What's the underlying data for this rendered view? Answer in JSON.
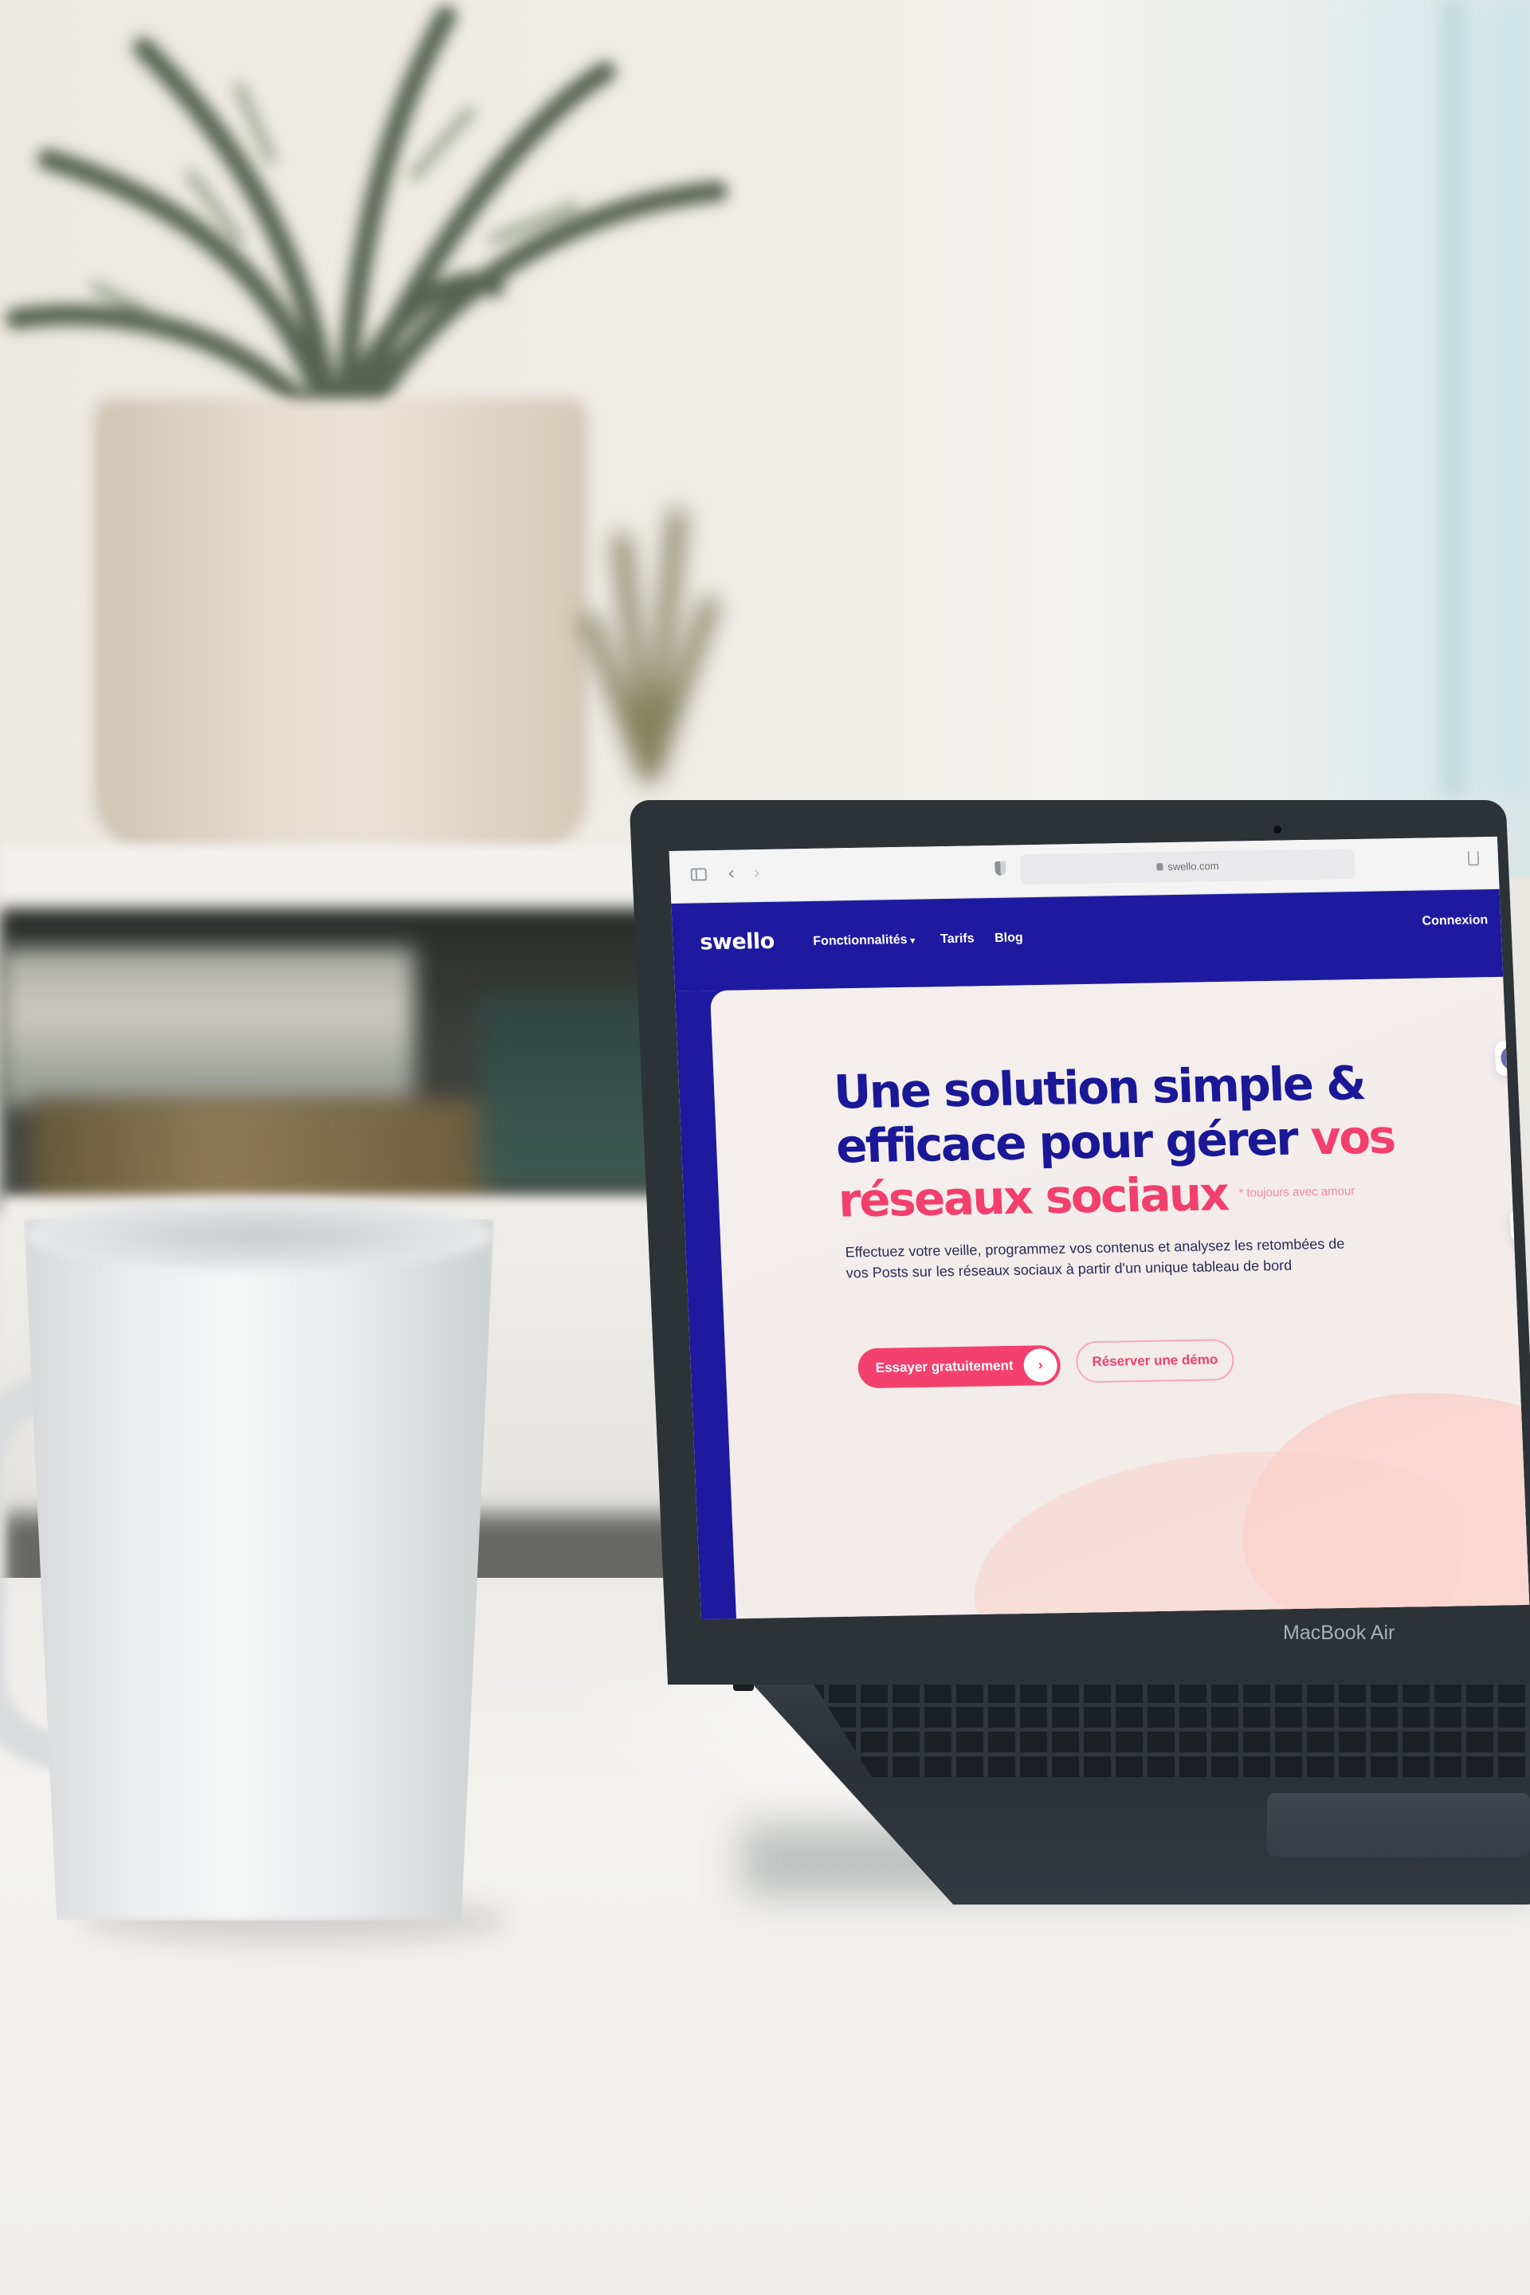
{
  "scene": {
    "laptop_label": "MacBook Air"
  },
  "browser": {
    "url": "swello.com"
  },
  "site": {
    "logo": "swello",
    "nav": {
      "features": "Fonctionnalités",
      "pricing": "Tarifs",
      "blog": "Blog",
      "login": "Connexion"
    },
    "hero": {
      "title_line1": "Une solution simple &",
      "title_line2_a": "efficace pour gérer ",
      "title_line2_b": "vos",
      "title_line3": "réseaux sociaux",
      "note": "* toujours avec amour",
      "description": "Effectuez votre veille, programmez vos contenus et analysez les retombées de vos Posts sur les réseaux sociaux à partir d'un unique tableau de bord",
      "primary_button": "Essayer gratuitement",
      "secondary_button": "Réserver une démo"
    },
    "social_icons": [
      "linkedin-icon",
      "facebook-icon"
    ],
    "colors": {
      "brand_blue": "#1d1aa0",
      "accent_pink": "#f33f6b"
    }
  }
}
